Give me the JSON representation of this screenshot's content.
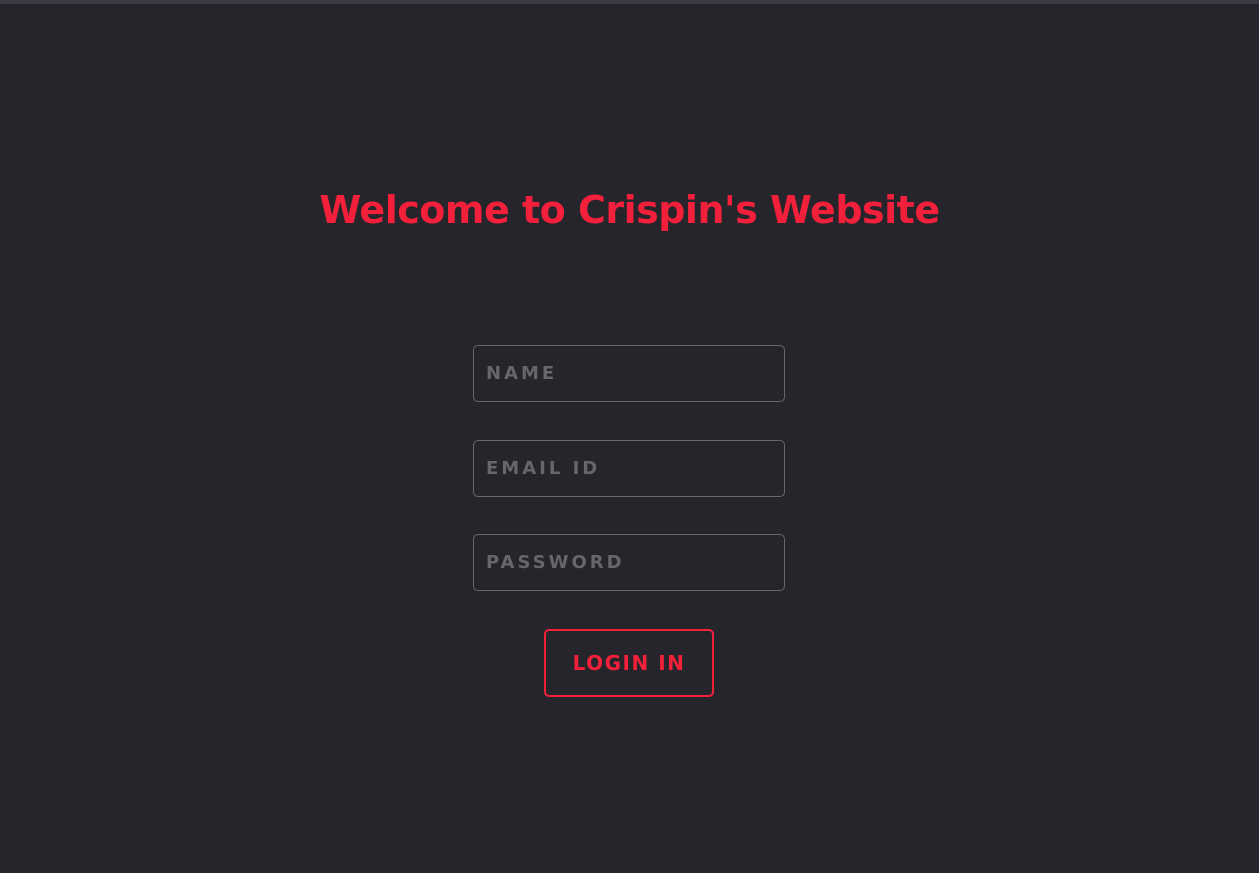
{
  "page": {
    "title": "Welcome to Crispin's Website"
  },
  "form": {
    "name_placeholder": "NAME",
    "name_value": "",
    "email_placeholder": "EMAIL ID",
    "email_value": "",
    "password_placeholder": "PASSWORD",
    "password_value": "",
    "submit_label": "LOGIN IN"
  },
  "colors": {
    "background": "#26252b",
    "accent": "#f2203a",
    "field_border": "#68676d",
    "placeholder": "#66666c"
  }
}
